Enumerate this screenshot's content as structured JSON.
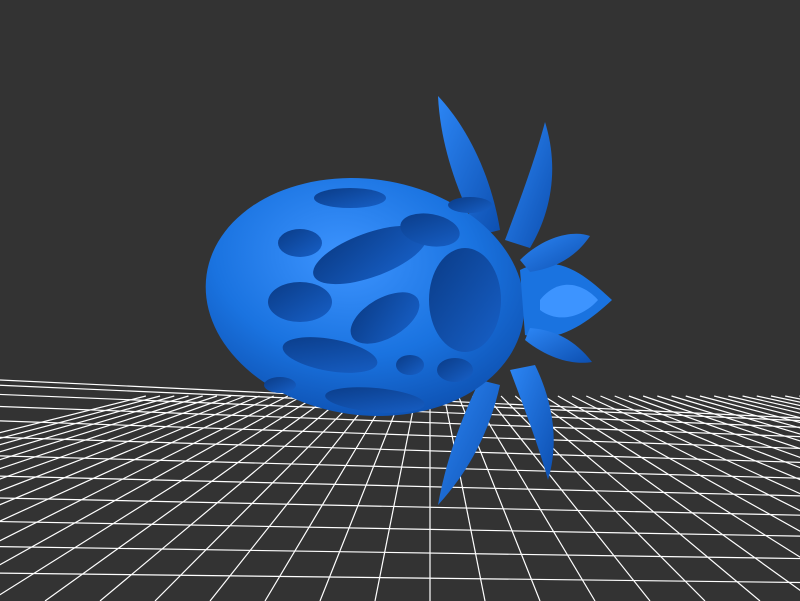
{
  "viewer": {
    "background_color": "#333333",
    "grid_color": "#ffffff",
    "model_color": "#1a73e0",
    "model_highlight": "#4aa0ff",
    "model_shadow": "#0a3f8c",
    "model_description_icon": "pierced-egg-with-leaves-model"
  }
}
